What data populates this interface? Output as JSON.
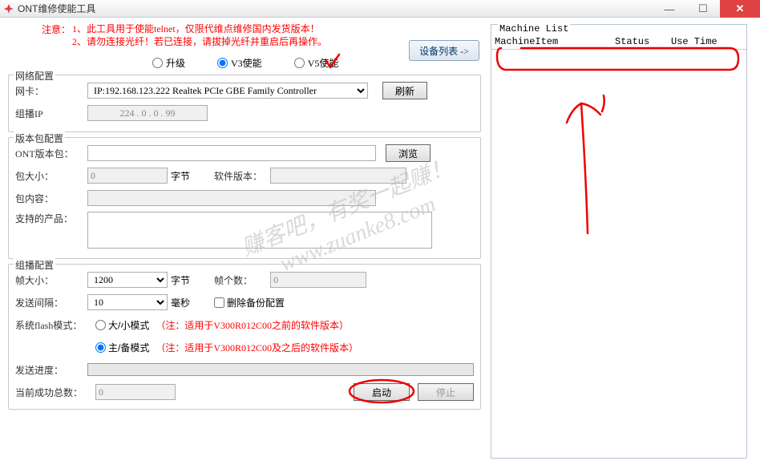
{
  "window": {
    "title": "ONT维修使能工具"
  },
  "warn": {
    "label": "注意：",
    "line1": "1、此工具用于使能telnet，仅限代维点维修国内发货版本！",
    "line2": "2、请勿连接光纤！若已连接，请拔掉光纤并重启后再操作。"
  },
  "devlist_btn": "设备列表 ->",
  "mode": {
    "upgrade": "升级",
    "v3": "V3使能",
    "v5": "V5使能",
    "selected": "v3"
  },
  "net": {
    "legend": "网络配置",
    "nic_label": "网卡：",
    "nic_value": "IP:192.168.123.222 Realtek PCIe GBE Family Controller",
    "refresh": "刷新",
    "mcast_label": "组播IP",
    "mcast_value": "224 . 0 . 0 . 99"
  },
  "pkg": {
    "legend": "版本包配置",
    "ont_label": "ONT版本包：",
    "ont_value": "",
    "browse": "浏览",
    "size_label": "包大小：",
    "size_value": "0",
    "size_unit": "字节",
    "ver_label": "软件版本：",
    "ver_value": "",
    "content_label": "包内容：",
    "content_value": "",
    "support_label": "支持的产品：",
    "support_value": ""
  },
  "mcast": {
    "legend": "组播配置",
    "frame_label": "帧大小：",
    "frame_value": "1200",
    "frame_unit": "字节",
    "count_label": "帧个数：",
    "count_value": "0",
    "interval_label": "发送间隔：",
    "interval_value": "10",
    "interval_unit": "毫秒",
    "del_backup": "删除备份配置",
    "flash_label": "系统flash模式：",
    "flash_small": "大/小模式",
    "flash_small_note": "（注：适用于V300R012C00之前的软件版本）",
    "flash_main": "主/备模式",
    "flash_main_note": "（注：适用于V300R012C00及之后的软件版本）",
    "flash_selected": "main",
    "progress_label": "发送进度：",
    "success_label": "当前成功总数：",
    "success_value": "0",
    "start": "启动",
    "stop": "停止"
  },
  "ml": {
    "legend": "Machine List",
    "col1": "MachineItem",
    "col2": "Status",
    "col3": "Use Time"
  },
  "watermark": {
    "line1": "赚客吧，有奖一起赚！",
    "line2": "www.zuanke8.com"
  }
}
